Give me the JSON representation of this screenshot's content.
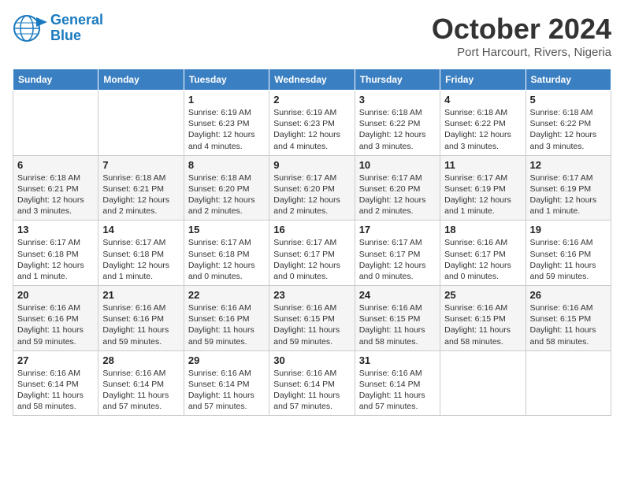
{
  "header": {
    "logo_line1": "General",
    "logo_line2": "Blue",
    "month": "October 2024",
    "location": "Port Harcourt, Rivers, Nigeria"
  },
  "weekdays": [
    "Sunday",
    "Monday",
    "Tuesday",
    "Wednesday",
    "Thursday",
    "Friday",
    "Saturday"
  ],
  "weeks": [
    [
      {
        "day": "",
        "info": ""
      },
      {
        "day": "",
        "info": ""
      },
      {
        "day": "1",
        "info": "Sunrise: 6:19 AM\nSunset: 6:23 PM\nDaylight: 12 hours and 4 minutes."
      },
      {
        "day": "2",
        "info": "Sunrise: 6:19 AM\nSunset: 6:23 PM\nDaylight: 12 hours and 4 minutes."
      },
      {
        "day": "3",
        "info": "Sunrise: 6:18 AM\nSunset: 6:22 PM\nDaylight: 12 hours and 3 minutes."
      },
      {
        "day": "4",
        "info": "Sunrise: 6:18 AM\nSunset: 6:22 PM\nDaylight: 12 hours and 3 minutes."
      },
      {
        "day": "5",
        "info": "Sunrise: 6:18 AM\nSunset: 6:22 PM\nDaylight: 12 hours and 3 minutes."
      }
    ],
    [
      {
        "day": "6",
        "info": "Sunrise: 6:18 AM\nSunset: 6:21 PM\nDaylight: 12 hours and 3 minutes."
      },
      {
        "day": "7",
        "info": "Sunrise: 6:18 AM\nSunset: 6:21 PM\nDaylight: 12 hours and 2 minutes."
      },
      {
        "day": "8",
        "info": "Sunrise: 6:18 AM\nSunset: 6:20 PM\nDaylight: 12 hours and 2 minutes."
      },
      {
        "day": "9",
        "info": "Sunrise: 6:17 AM\nSunset: 6:20 PM\nDaylight: 12 hours and 2 minutes."
      },
      {
        "day": "10",
        "info": "Sunrise: 6:17 AM\nSunset: 6:20 PM\nDaylight: 12 hours and 2 minutes."
      },
      {
        "day": "11",
        "info": "Sunrise: 6:17 AM\nSunset: 6:19 PM\nDaylight: 12 hours and 1 minute."
      },
      {
        "day": "12",
        "info": "Sunrise: 6:17 AM\nSunset: 6:19 PM\nDaylight: 12 hours and 1 minute."
      }
    ],
    [
      {
        "day": "13",
        "info": "Sunrise: 6:17 AM\nSunset: 6:18 PM\nDaylight: 12 hours and 1 minute."
      },
      {
        "day": "14",
        "info": "Sunrise: 6:17 AM\nSunset: 6:18 PM\nDaylight: 12 hours and 1 minute."
      },
      {
        "day": "15",
        "info": "Sunrise: 6:17 AM\nSunset: 6:18 PM\nDaylight: 12 hours and 0 minutes."
      },
      {
        "day": "16",
        "info": "Sunrise: 6:17 AM\nSunset: 6:17 PM\nDaylight: 12 hours and 0 minutes."
      },
      {
        "day": "17",
        "info": "Sunrise: 6:17 AM\nSunset: 6:17 PM\nDaylight: 12 hours and 0 minutes."
      },
      {
        "day": "18",
        "info": "Sunrise: 6:16 AM\nSunset: 6:17 PM\nDaylight: 12 hours and 0 minutes."
      },
      {
        "day": "19",
        "info": "Sunrise: 6:16 AM\nSunset: 6:16 PM\nDaylight: 11 hours and 59 minutes."
      }
    ],
    [
      {
        "day": "20",
        "info": "Sunrise: 6:16 AM\nSunset: 6:16 PM\nDaylight: 11 hours and 59 minutes."
      },
      {
        "day": "21",
        "info": "Sunrise: 6:16 AM\nSunset: 6:16 PM\nDaylight: 11 hours and 59 minutes."
      },
      {
        "day": "22",
        "info": "Sunrise: 6:16 AM\nSunset: 6:16 PM\nDaylight: 11 hours and 59 minutes."
      },
      {
        "day": "23",
        "info": "Sunrise: 6:16 AM\nSunset: 6:15 PM\nDaylight: 11 hours and 59 minutes."
      },
      {
        "day": "24",
        "info": "Sunrise: 6:16 AM\nSunset: 6:15 PM\nDaylight: 11 hours and 58 minutes."
      },
      {
        "day": "25",
        "info": "Sunrise: 6:16 AM\nSunset: 6:15 PM\nDaylight: 11 hours and 58 minutes."
      },
      {
        "day": "26",
        "info": "Sunrise: 6:16 AM\nSunset: 6:15 PM\nDaylight: 11 hours and 58 minutes."
      }
    ],
    [
      {
        "day": "27",
        "info": "Sunrise: 6:16 AM\nSunset: 6:14 PM\nDaylight: 11 hours and 58 minutes."
      },
      {
        "day": "28",
        "info": "Sunrise: 6:16 AM\nSunset: 6:14 PM\nDaylight: 11 hours and 57 minutes."
      },
      {
        "day": "29",
        "info": "Sunrise: 6:16 AM\nSunset: 6:14 PM\nDaylight: 11 hours and 57 minutes."
      },
      {
        "day": "30",
        "info": "Sunrise: 6:16 AM\nSunset: 6:14 PM\nDaylight: 11 hours and 57 minutes."
      },
      {
        "day": "31",
        "info": "Sunrise: 6:16 AM\nSunset: 6:14 PM\nDaylight: 11 hours and 57 minutes."
      },
      {
        "day": "",
        "info": ""
      },
      {
        "day": "",
        "info": ""
      }
    ]
  ]
}
